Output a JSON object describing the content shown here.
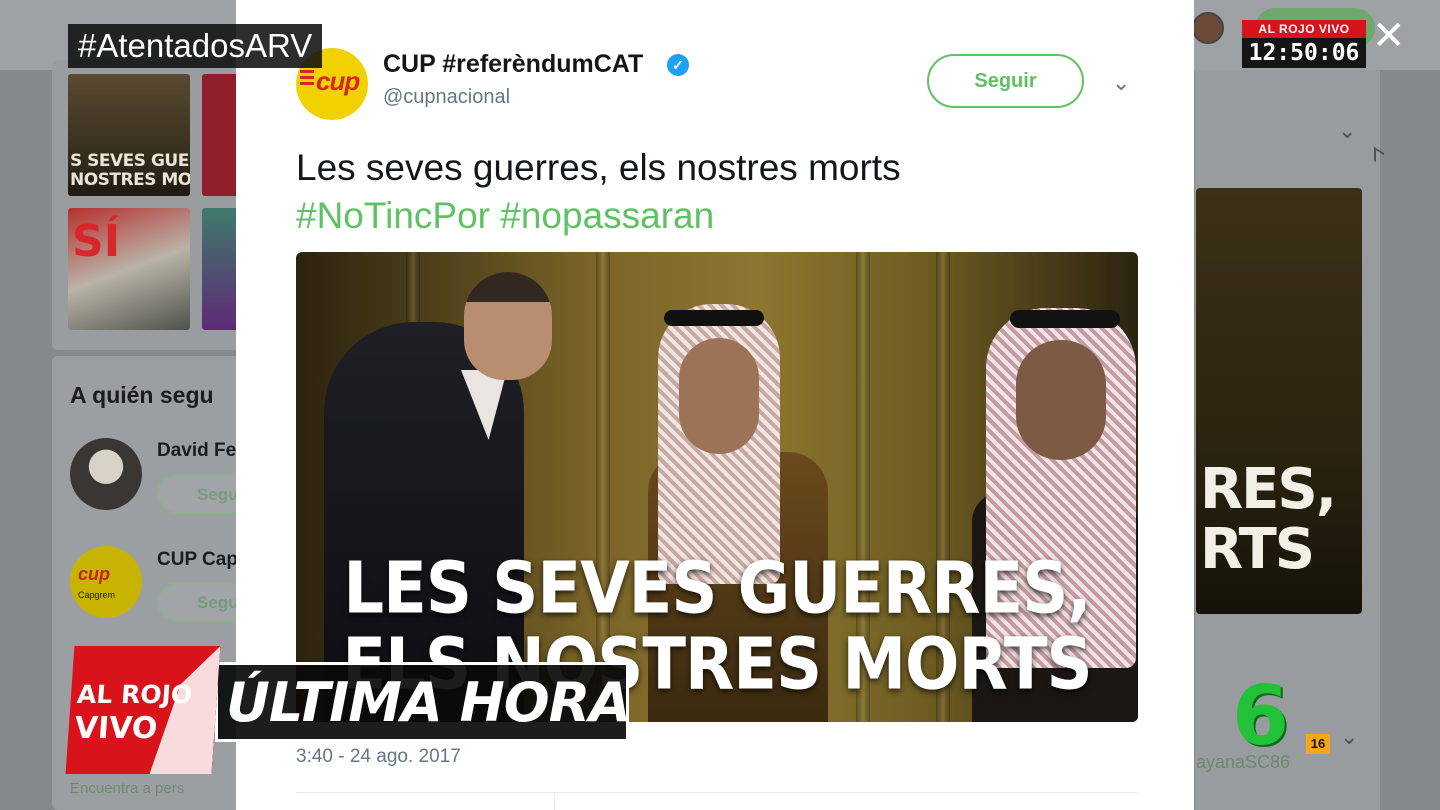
{
  "broadcast": {
    "hashtag": "#AtentadosARV",
    "clock_logo": "AL ROJO VIVO",
    "clock_time": "12:50:06",
    "breaking_label": "ÚLTIMA HORA",
    "show_logo_line1": "AL ROJO",
    "show_logo_line2": "VIVO",
    "rating": "16",
    "channel_icon": "lasexta-6-logo",
    "close_icon": "close-icon"
  },
  "tweet": {
    "display_name": "CUP #referèndumCAT",
    "handle": "@cupnacional",
    "verified_icon": "verified-check-icon",
    "avatar_logo": "cup",
    "follow_label": "Seguir",
    "text": "Les seves guerres, els nostres morts",
    "hashtags": [
      "#NoTincPor",
      "#nopassaran"
    ],
    "media_caption_line1": "LES SEVES GUERRES,",
    "media_caption_line2": "ELS NOSTRES MORTS",
    "date": "3:40 - 24 ago. 2017"
  },
  "background": {
    "who_to_follow_title": "A quién segu",
    "suggestions": [
      {
        "name": "David Fe",
        "button": "Segu"
      },
      {
        "name": "CUP Cap",
        "button": "Segu",
        "avatar_text": "cup",
        "avatar_sub": "Capgrem"
      }
    ],
    "thumb1_text": "S SEVES GUERR\nNOSTRES MO",
    "thumb3_text": "SÍ",
    "find_people_link": "Encuentra a pers",
    "right_image_text": "RES,\nRTS",
    "right_user": "ayanaSC86"
  },
  "colors": {
    "accent_green": "#5ec262",
    "verified_blue": "#1da1f2",
    "arv_red": "#d8131c",
    "lasexta_green": "#23c13a"
  }
}
